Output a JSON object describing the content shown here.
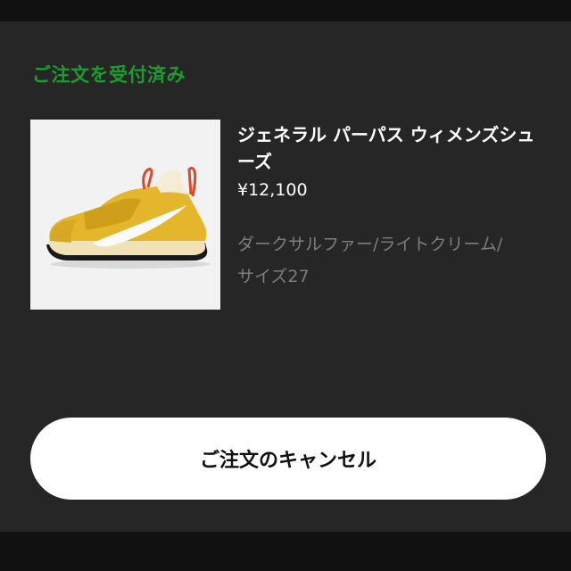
{
  "order": {
    "status_label": "ご注文を受付済み",
    "status_color": "#1a9c2e"
  },
  "product": {
    "name": "ジェネラル パーパス ウィメンズシューズ",
    "price": "¥12,100",
    "color_line": "ダークサルファー/ライトクリーム/",
    "size_line": "サイズ27",
    "image_icon": "sneaker-image"
  },
  "actions": {
    "cancel_label": "ご注文のキャンセル"
  }
}
